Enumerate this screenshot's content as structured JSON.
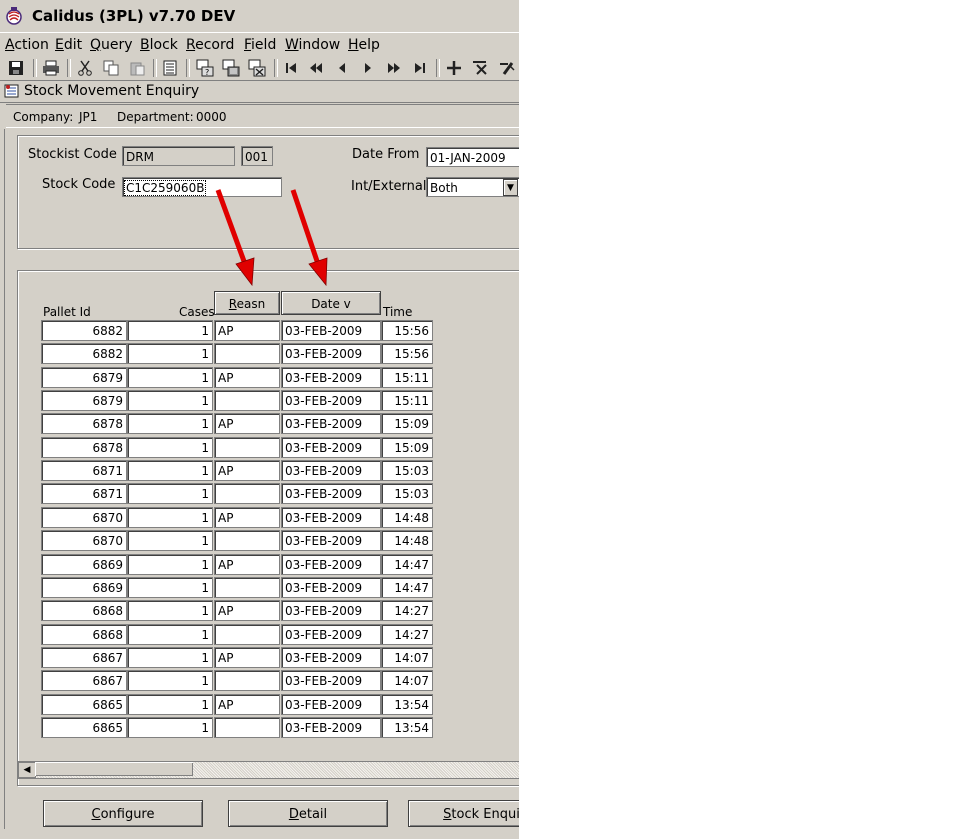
{
  "window": {
    "title": "Calidus (3PL) v7.70 DEV"
  },
  "menu": {
    "items": [
      {
        "label": "Action",
        "key": "A",
        "rest": "ction"
      },
      {
        "label": "Edit",
        "key": "E",
        "rest": "dit"
      },
      {
        "label": "Query",
        "key": "Q",
        "rest": "uery"
      },
      {
        "label": "Block",
        "key": "B",
        "rest": "lock"
      },
      {
        "label": "Record",
        "key": "R",
        "rest": "ecord"
      },
      {
        "label": "Field",
        "key": "F",
        "rest": "ield"
      },
      {
        "label": "Window",
        "key": "W",
        "rest": "indow"
      },
      {
        "label": "Help",
        "key": "H",
        "rest": "elp"
      }
    ]
  },
  "toolbar": {
    "icons": [
      "save-icon",
      "print-icon",
      "cut-icon",
      "copy-icon",
      "paste-icon",
      "list-icon",
      "query-icon",
      "execute-query-icon",
      "cancel-query-icon",
      "first-record-icon",
      "previous-set-icon",
      "previous-record-icon",
      "next-record-icon",
      "next-set-icon",
      "last-record-icon",
      "insert-record-icon",
      "delete-record-icon",
      "clear-record-icon"
    ]
  },
  "form": {
    "title": "Stock Movement Enquiry"
  },
  "context": {
    "company_label": "Company:",
    "company": "JP1",
    "department_label": "Department:",
    "department": "0000"
  },
  "header": {
    "stockist_code_label": "Stockist Code",
    "stockist_code": "DRM",
    "stockist_suffix": "001",
    "stock_code_label": "Stock Code",
    "stock_code": "C1C259060B",
    "date_from_label": "Date From",
    "date_from": "01-JAN-2009",
    "int_external_label": "Int/External",
    "int_external": "Both"
  },
  "table": {
    "col_pallet": "Pallet Id",
    "col_cases": "Cases",
    "col_reason": "Reasn",
    "col_reason_key": "R",
    "col_reason_rest": "easn",
    "col_date": "Date v",
    "col_time": "Time",
    "rows": [
      {
        "pallet": "6882",
        "cases": "1",
        "reason": "AP",
        "date": "03-FEB-2009",
        "time": "15:56"
      },
      {
        "pallet": "6882",
        "cases": "1",
        "reason": "",
        "date": "03-FEB-2009",
        "time": "15:56"
      },
      {
        "pallet": "6879",
        "cases": "1",
        "reason": "AP",
        "date": "03-FEB-2009",
        "time": "15:11"
      },
      {
        "pallet": "6879",
        "cases": "1",
        "reason": "",
        "date": "03-FEB-2009",
        "time": "15:11"
      },
      {
        "pallet": "6878",
        "cases": "1",
        "reason": "AP",
        "date": "03-FEB-2009",
        "time": "15:09"
      },
      {
        "pallet": "6878",
        "cases": "1",
        "reason": "",
        "date": "03-FEB-2009",
        "time": "15:09"
      },
      {
        "pallet": "6871",
        "cases": "1",
        "reason": "AP",
        "date": "03-FEB-2009",
        "time": "15:03"
      },
      {
        "pallet": "6871",
        "cases": "1",
        "reason": "",
        "date": "03-FEB-2009",
        "time": "15:03"
      },
      {
        "pallet": "6870",
        "cases": "1",
        "reason": "AP",
        "date": "03-FEB-2009",
        "time": "14:48"
      },
      {
        "pallet": "6870",
        "cases": "1",
        "reason": "",
        "date": "03-FEB-2009",
        "time": "14:48"
      },
      {
        "pallet": "6869",
        "cases": "1",
        "reason": "AP",
        "date": "03-FEB-2009",
        "time": "14:47"
      },
      {
        "pallet": "6869",
        "cases": "1",
        "reason": "",
        "date": "03-FEB-2009",
        "time": "14:47"
      },
      {
        "pallet": "6868",
        "cases": "1",
        "reason": "AP",
        "date": "03-FEB-2009",
        "time": "14:27"
      },
      {
        "pallet": "6868",
        "cases": "1",
        "reason": "",
        "date": "03-FEB-2009",
        "time": "14:27"
      },
      {
        "pallet": "6867",
        "cases": "1",
        "reason": "AP",
        "date": "03-FEB-2009",
        "time": "14:07"
      },
      {
        "pallet": "6867",
        "cases": "1",
        "reason": "",
        "date": "03-FEB-2009",
        "time": "14:07"
      },
      {
        "pallet": "6865",
        "cases": "1",
        "reason": "AP",
        "date": "03-FEB-2009",
        "time": "13:54"
      },
      {
        "pallet": "6865",
        "cases": "1",
        "reason": "",
        "date": "03-FEB-2009",
        "time": "13:54"
      }
    ]
  },
  "buttons": {
    "configure": {
      "key": "C",
      "rest": "onfigure"
    },
    "detail": {
      "key": "D",
      "rest": "etail"
    },
    "stock_enquiry": {
      "key": "S",
      "rest": "tock Enquiry"
    }
  },
  "colors": {
    "arrow": "#e00000",
    "chrome": "#d4d0c8"
  }
}
